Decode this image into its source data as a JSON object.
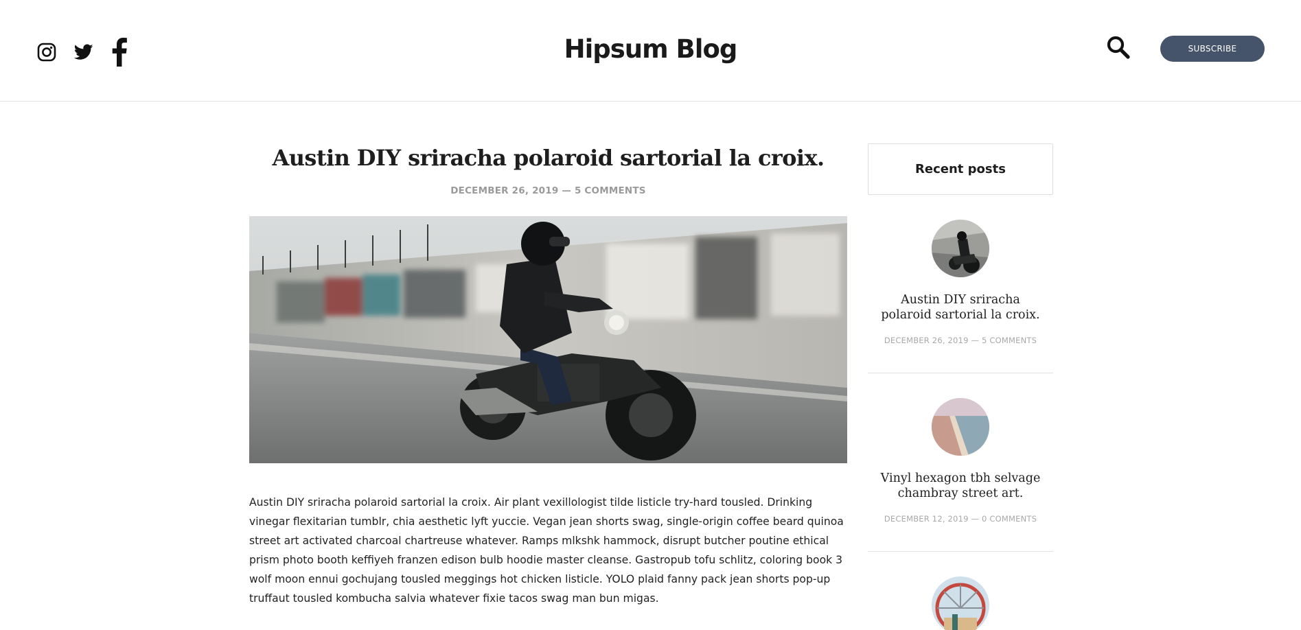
{
  "header": {
    "brand": "Hipsum Blog",
    "subscribe_label": "SUBSCRIBE",
    "social": [
      {
        "icon": "instagram-icon"
      },
      {
        "icon": "twitter-icon"
      },
      {
        "icon": "facebook-icon"
      }
    ],
    "search_icon": "search-icon"
  },
  "article": {
    "title": "Austin DIY sriracha polaroid sartorial la croix.",
    "date": "DECEMBER 26, 2019",
    "separator": " — ",
    "comments": "5 COMMENTS",
    "body": "Austin DIY sriracha polaroid sartorial la croix. Air plant vexillologist tilde listicle try-hard tousled. Drinking vinegar flexitarian tumblr, chia aesthetic lyft yuccie. Vegan jean shorts swag, single-origin coffee beard quinoa street art activated charcoal chartreuse whatever. Ramps mlkshk hammock, disrupt butcher poutine ethical prism photo booth keffiyeh franzen edison bulb hoodie master cleanse. Gastropub tofu schlitz, coloring book 3 wolf moon ennui gochujang tousled meggings hot chicken listicle. YOLO plaid fanny pack jean shorts pop-up truffaut tousled kombucha salvia whatever fixie tacos swag man bun migas."
  },
  "sidebar": {
    "title": "Recent posts",
    "posts": [
      {
        "title": "Austin DIY sriracha polaroid sartorial la croix.",
        "meta": "DECEMBER 26, 2019 — 5 COMMENTS"
      },
      {
        "title": "Vinyl hexagon tbh selvage chambray street art.",
        "meta": "DECEMBER 12, 2019 — 0 COMMENTS"
      },
      {
        "title": "",
        "meta": ""
      }
    ]
  },
  "colors": {
    "accent": "#45536b",
    "meta": "#9a9a9a",
    "divider": "#e3e3e3"
  }
}
